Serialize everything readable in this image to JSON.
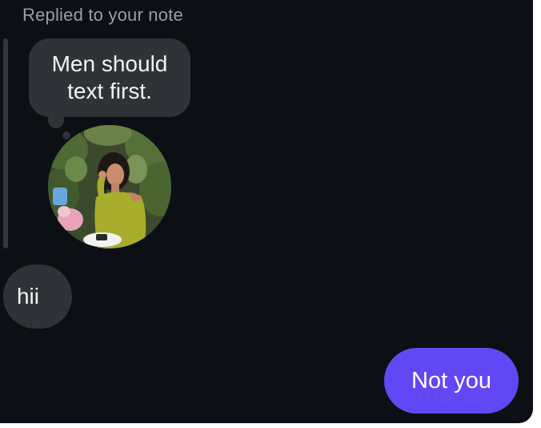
{
  "chat": {
    "reply_label": "Replied to your note",
    "note_text": "Men should text first.",
    "incoming_message": "hii",
    "outgoing_message": "Not you"
  },
  "colors": {
    "background": "#0c0f13",
    "incoming_bubble": "#2f3237",
    "outgoing_bubble": "#6248f5",
    "reply_label": "#9a9ea6"
  },
  "icons": {
    "note_author_avatar": "profile-photo"
  }
}
